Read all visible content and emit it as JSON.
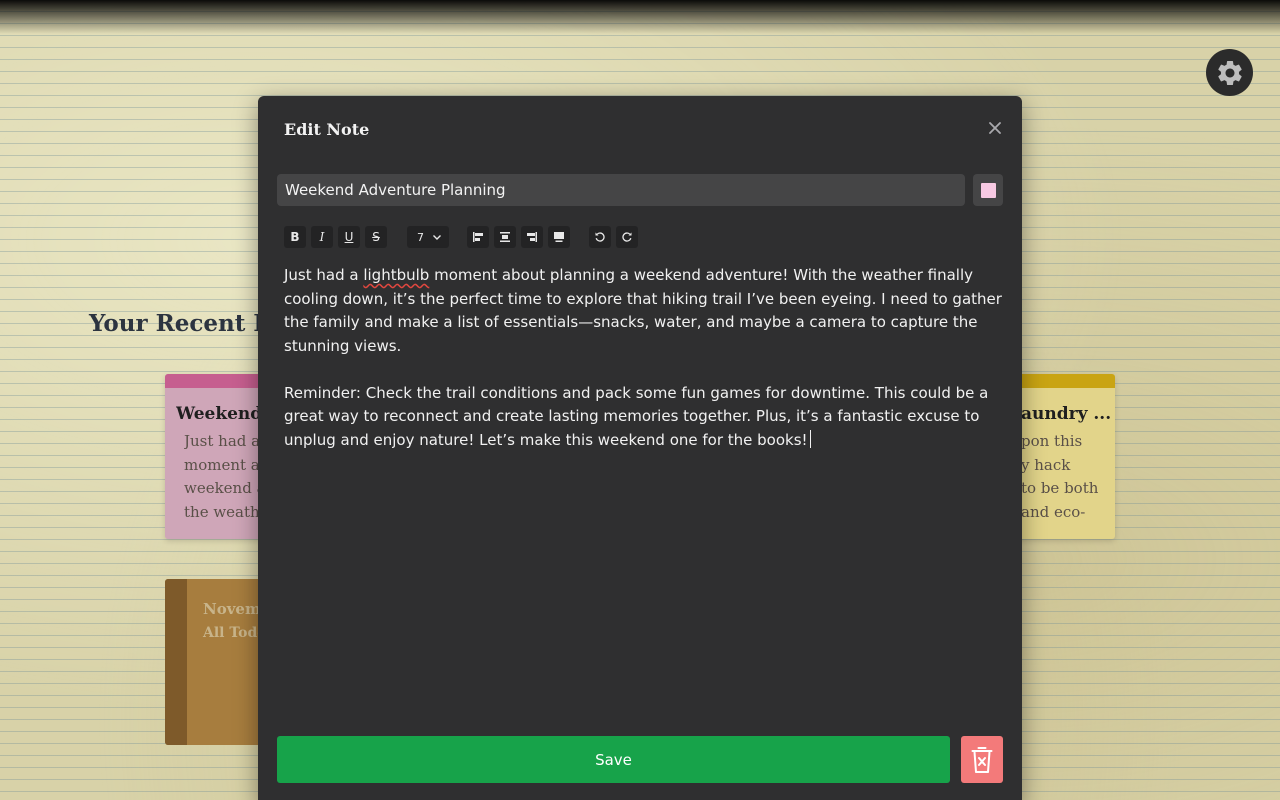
{
  "background": {
    "heading": "Your Recent Note",
    "notes": [
      {
        "title": "Weekend A",
        "body": "Just had a l\nmoment ab\nweekend ac\nthe weathe"
      },
      {
        "title": "aundry ...",
        "body": "pon this\ny hack\nto be both\nand eco-"
      }
    ],
    "book": {
      "line1": "Novem",
      "line2": "All Todo"
    }
  },
  "modal": {
    "title": "Edit Note",
    "title_value": "Weekend Adventure Planning",
    "selected_color": "#f7c9e3",
    "toolbar": {
      "bold": "B",
      "italic": "I",
      "underline": "U",
      "strikethrough": "S",
      "font_size": "7"
    },
    "content": {
      "para1_before": "Just had a ",
      "para1_misspelled": "lightbulb",
      "para1_after": " moment about planning a weekend adventure! With the weather finally cooling down, it’s the perfect time to explore that hiking trail I’ve been eyeing. I need to gather the family and make a list of essentials—snacks, water, and maybe a camera to capture the stunning views.",
      "para2": "Reminder: Check the trail conditions and pack some fun games for downtime. This could be a great way to reconnect and create lasting memories together. Plus, it’s a fantastic excuse to unplug and enjoy nature! Let’s make this weekend one for the books!"
    },
    "save_label": "Save"
  },
  "colors": {
    "save": "#17a34a",
    "delete": "#f37a7a",
    "modal_bg": "#2f2f30"
  }
}
